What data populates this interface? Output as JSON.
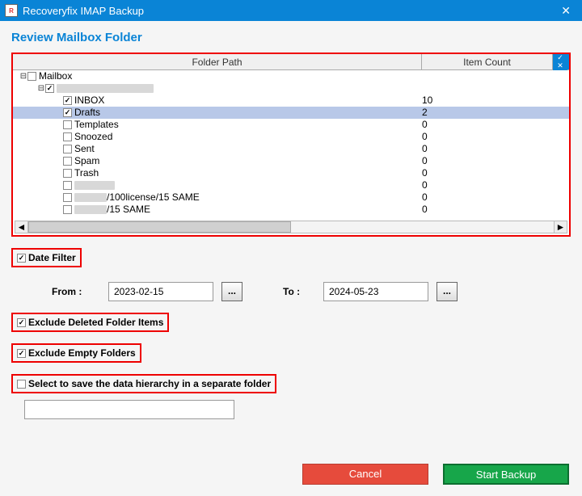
{
  "window": {
    "title": "Recoveryfix IMAP Backup",
    "icon_letter": "R"
  },
  "heading": "Review Mailbox Folder",
  "table": {
    "headers": {
      "path": "Folder Path",
      "count": "Item Count"
    },
    "rows": [
      {
        "indent": 0,
        "toggle": true,
        "checked": false,
        "label": "Mailbox",
        "count": ""
      },
      {
        "indent": 1,
        "toggle": true,
        "checked": true,
        "label": "________________________",
        "blurred": true,
        "count": ""
      },
      {
        "indent": 2,
        "toggle": false,
        "checked": true,
        "label": "INBOX",
        "count": "10"
      },
      {
        "indent": 2,
        "toggle": false,
        "checked": true,
        "label": "Drafts",
        "count": "2",
        "selected": true
      },
      {
        "indent": 2,
        "toggle": false,
        "checked": false,
        "label": "Templates",
        "count": "0"
      },
      {
        "indent": 2,
        "toggle": false,
        "checked": false,
        "label": "Snoozed",
        "count": "0"
      },
      {
        "indent": 2,
        "toggle": false,
        "checked": false,
        "label": "Sent",
        "count": "0"
      },
      {
        "indent": 2,
        "toggle": false,
        "checked": false,
        "label": "Spam",
        "count": "0"
      },
      {
        "indent": 2,
        "toggle": false,
        "checked": false,
        "label": "Trash",
        "count": "0"
      },
      {
        "indent": 2,
        "toggle": false,
        "checked": false,
        "label": "__________",
        "blurred": true,
        "count": "0"
      },
      {
        "indent": 2,
        "toggle": false,
        "checked": false,
        "label_prefix_blur": "________",
        "label": "/100license/15  SAME",
        "count": "0"
      },
      {
        "indent": 2,
        "toggle": false,
        "checked": false,
        "label_prefix_blur": "________",
        "label": "/15  SAME",
        "count": "0"
      }
    ]
  },
  "options": {
    "date_filter": {
      "label": "Date Filter",
      "checked": true
    },
    "from_label": "From :",
    "from_value": "2023-02-15",
    "to_label": "To :",
    "to_value": "2024-05-23",
    "exclude_deleted": {
      "label": "Exclude Deleted Folder Items",
      "checked": true
    },
    "exclude_empty": {
      "label": "Exclude Empty Folders",
      "checked": true
    },
    "save_hierarchy": {
      "label": "Select to save the data hierarchy in a separate folder",
      "checked": false
    },
    "ellipsis": "..."
  },
  "buttons": {
    "cancel": "Cancel",
    "start": "Start Backup"
  }
}
